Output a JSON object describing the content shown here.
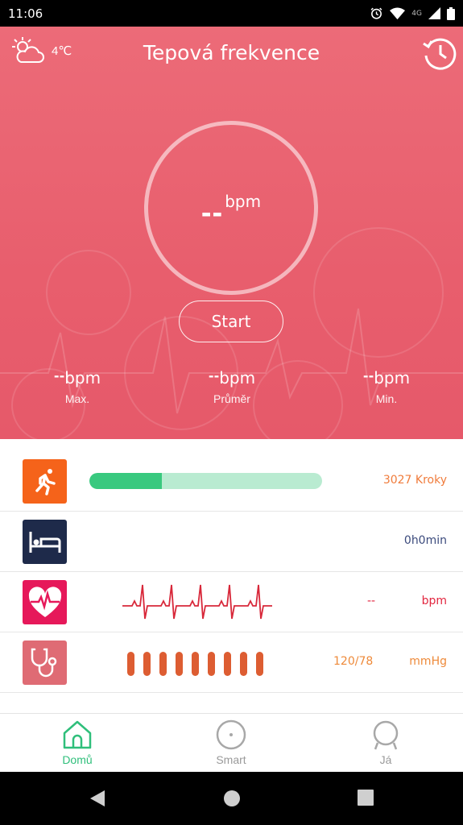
{
  "status_bar": {
    "time": "11:06",
    "network": "4G"
  },
  "header": {
    "temperature": "4℃",
    "title": "Tepová frekvence"
  },
  "heart_rate": {
    "current": "--",
    "unit": "bpm",
    "start_label": "Start",
    "stats": [
      {
        "value": "--",
        "unit": "bpm",
        "label": "Max."
      },
      {
        "value": "--",
        "unit": "bpm",
        "label": "Průměr"
      },
      {
        "value": "--",
        "unit": "bpm",
        "label": "Min."
      }
    ]
  },
  "rows": {
    "steps": {
      "value": "3027 Kroky",
      "progress_percent": 31,
      "color": "#f07c3c"
    },
    "sleep": {
      "value": "0h0min",
      "color": "#3b4a7c"
    },
    "heart": {
      "value": "--",
      "unit": "bpm",
      "color": "#e2263f"
    },
    "pressure": {
      "value": "120/78",
      "unit": "mmHg",
      "color": "#ee8a3a"
    }
  },
  "bottom_nav": [
    {
      "label": "Domů",
      "active": true
    },
    {
      "label": "Smart",
      "active": false
    },
    {
      "label": "Já",
      "active": false
    }
  ],
  "colors": {
    "hero": "#e85e6d",
    "accent_green": "#2fbf7b",
    "steps_icon": "#f5631a",
    "sleep_icon": "#1e2a4a",
    "heart_icon": "#e6185a",
    "pressure_icon": "#df6b74"
  }
}
